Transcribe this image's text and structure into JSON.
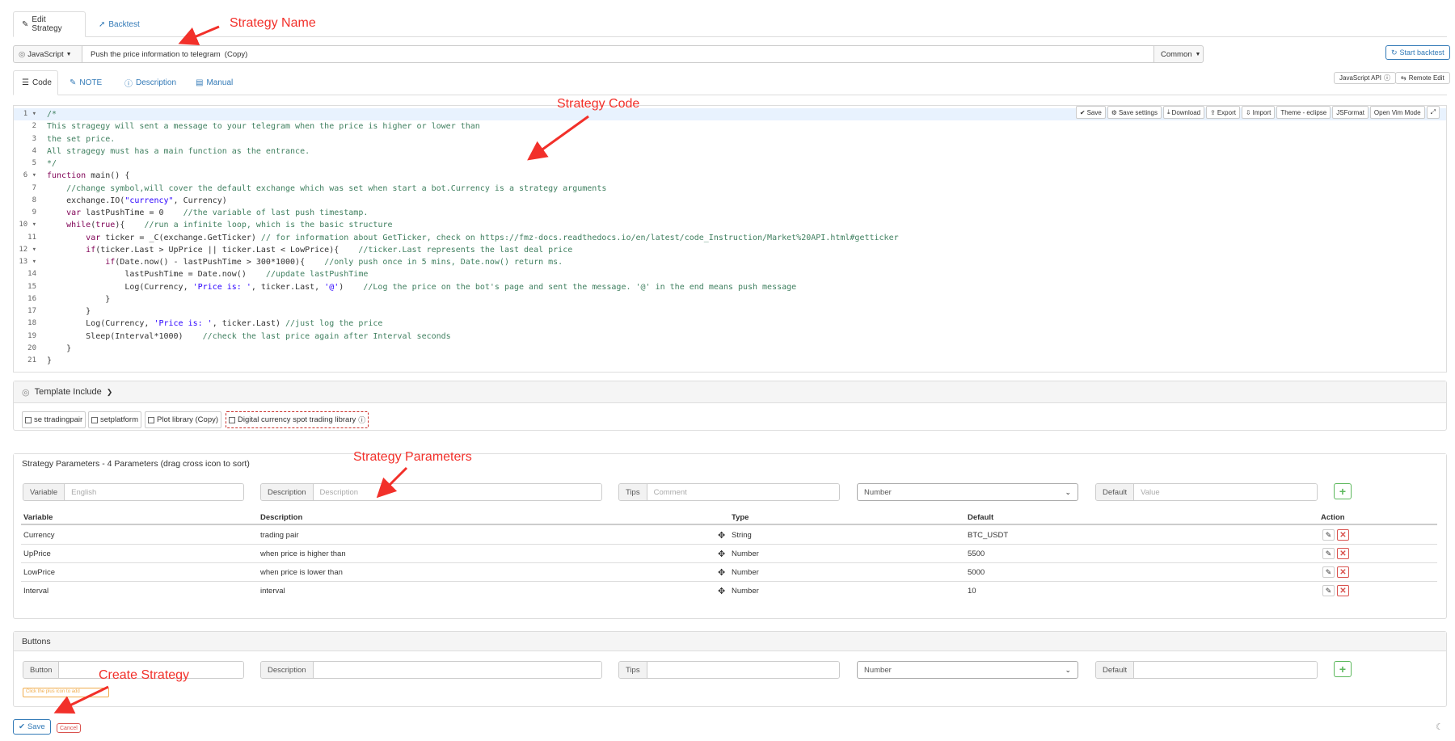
{
  "top_tabs": {
    "edit_strategy": "Edit Strategy",
    "backtest": "Backtest"
  },
  "toolbar": {
    "language": "JavaScript",
    "strategy_name": "Push the price information to telegram  (Copy)",
    "category": "Common",
    "start_backtest": "Start backtest",
    "javascript_api": "JavaScript API",
    "remote_edit": "Remote Edit"
  },
  "editor_tabs": {
    "code": "Code",
    "note": "NOTE",
    "description": "Description",
    "manual": "Manual"
  },
  "editor_buttons": {
    "save": "Save",
    "save_settings": "Save settings",
    "download": "Download",
    "export": "Export",
    "import": "Import",
    "theme": "Theme - eclipse",
    "jsformat": "JSFormat",
    "vim_mode": "Open Vim Mode"
  },
  "code": {
    "lines": [
      [
        {
          "t": "/*",
          "c": "cm"
        }
      ],
      [
        {
          "t": "This stragegy will sent a message to your telegram when the price is higher or lower than",
          "c": "cm"
        }
      ],
      [
        {
          "t": "the set price.",
          "c": "cm"
        }
      ],
      [
        {
          "t": "All stragegy must has a main function as the entrance.",
          "c": "cm"
        }
      ],
      [
        {
          "t": "*/",
          "c": "cm"
        }
      ],
      [
        {
          "t": "function",
          "c": "kw"
        },
        {
          "t": " main() {"
        }
      ],
      [
        {
          "t": "    "
        },
        {
          "t": "//change symbol,will cover the default exchange which was set when start a bot.Currency is a strategy arguments",
          "c": "cm"
        }
      ],
      [
        {
          "t": "    exchange.IO("
        },
        {
          "t": "\"currency\"",
          "c": "str"
        },
        {
          "t": ", Currency)"
        }
      ],
      [
        {
          "t": "    "
        },
        {
          "t": "var",
          "c": "kw"
        },
        {
          "t": " lastPushTime = 0    "
        },
        {
          "t": "//the variable of last push timestamp.",
          "c": "cm"
        }
      ],
      [
        {
          "t": "    "
        },
        {
          "t": "while",
          "c": "kw"
        },
        {
          "t": "("
        },
        {
          "t": "true",
          "c": "kw"
        },
        {
          "t": "){    "
        },
        {
          "t": "//run a infinite loop, which is the basic structure",
          "c": "cm"
        }
      ],
      [
        {
          "t": "        "
        },
        {
          "t": "var",
          "c": "kw"
        },
        {
          "t": " ticker = _C(exchange.GetTicker) "
        },
        {
          "t": "// for information about GetTicker, check on https://fmz-docs.readthedocs.io/en/latest/code_Instruction/Market%20API.html#getticker",
          "c": "cm"
        }
      ],
      [
        {
          "t": "        "
        },
        {
          "t": "if",
          "c": "kw"
        },
        {
          "t": "(ticker.Last > UpPrice || ticker.Last < LowPrice){    "
        },
        {
          "t": "//ticker.Last represents the last deal price",
          "c": "cm"
        }
      ],
      [
        {
          "t": "            "
        },
        {
          "t": "if",
          "c": "kw"
        },
        {
          "t": "(Date.now() - lastPushTime > 300*1000){    "
        },
        {
          "t": "//only push once in 5 mins, Date.now() return ms.",
          "c": "cm"
        }
      ],
      [
        {
          "t": "                lastPushTime = Date.now()    "
        },
        {
          "t": "//update lastPushTime",
          "c": "cm"
        }
      ],
      [
        {
          "t": "                Log(Currency, "
        },
        {
          "t": "'Price is: '",
          "c": "str"
        },
        {
          "t": ", ticker.Last, "
        },
        {
          "t": "'@'",
          "c": "str"
        },
        {
          "t": ")    "
        },
        {
          "t": "//Log the price on the bot's page and sent the message. '@' in the end means push message",
          "c": "cm"
        }
      ],
      [
        {
          "t": "            }"
        }
      ],
      [
        {
          "t": "        }"
        }
      ],
      [
        {
          "t": "        Log(Currency, "
        },
        {
          "t": "'Price is: '",
          "c": "str"
        },
        {
          "t": ", ticker.Last) "
        },
        {
          "t": "//just log the price",
          "c": "cm"
        }
      ],
      [
        {
          "t": "        Sleep(Interval*1000)    "
        },
        {
          "t": "//check the last price again after Interval seconds",
          "c": "cm"
        }
      ],
      [
        {
          "t": "    }"
        }
      ],
      [
        {
          "t": "}"
        }
      ]
    ],
    "foldable_lines": [
      1,
      6,
      10,
      12,
      13
    ]
  },
  "template_include": {
    "title": "Template Include",
    "items": [
      {
        "label": "se ttradingpair",
        "checked": false
      },
      {
        "label": "setplatform",
        "checked": false
      },
      {
        "label": "Plot library (Copy)",
        "checked": false
      },
      {
        "label": "Digital currency spot trading library",
        "checked": false
      }
    ]
  },
  "strategy_params": {
    "title": "Strategy Parameters - 4 Parameters (drag cross icon to sort)",
    "form": {
      "variable_label": "Variable",
      "variable_placeholder": "English",
      "description_label": "Description",
      "description_placeholder": "Description",
      "tips_label": "Tips",
      "tips_placeholder": "Comment",
      "type_value": "Number",
      "default_label": "Default",
      "default_placeholder": "Value"
    },
    "columns": [
      "Variable",
      "Description",
      "Type",
      "Default",
      "Action"
    ],
    "rows": [
      {
        "variable": "Currency",
        "description": "trading pair",
        "type": "String",
        "default": "BTC_USDT"
      },
      {
        "variable": "UpPrice",
        "description": "when price is higher than",
        "type": "Number",
        "default": "5500"
      },
      {
        "variable": "LowPrice",
        "description": "when price is lower than",
        "type": "Number",
        "default": "5000"
      },
      {
        "variable": "Interval",
        "description": "interval",
        "type": "Number",
        "default": "10"
      }
    ]
  },
  "buttons_panel": {
    "title": "Buttons",
    "button_label": "Button",
    "description_label": "Description",
    "tips_label": "Tips",
    "type_value": "Number",
    "default_label": "Default",
    "hint": "Click the plus icon to add"
  },
  "footer": {
    "save": "Save",
    "cancel": "Cancel"
  },
  "annotations": {
    "strategy_name": "Strategy Name",
    "strategy_code": "Strategy Code",
    "strategy_parameters": "Strategy Parameters",
    "create_strategy": "Create Strategy"
  },
  "colors": {
    "link": "#337ab7",
    "annotation": "#f2302a",
    "success": "#5cb85c",
    "danger": "#d9534f"
  }
}
